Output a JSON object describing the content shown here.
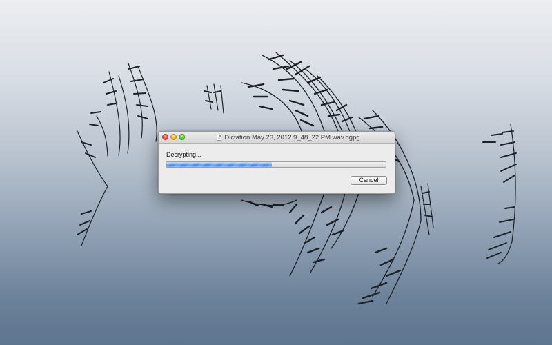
{
  "window": {
    "title": "Dictation May 23, 2012 9_48_22 PM.wav.dgpg",
    "title_icon": "document-icon"
  },
  "dialog": {
    "status_text": "Decrypting...",
    "progress_fraction": 0.48,
    "cancel_label": "Cancel"
  },
  "colors": {
    "progress_blue": "#4a8fe8",
    "close_red": "#f25a4a",
    "minimize_yellow": "#f3bd3a",
    "zoom_green": "#6ccd3e"
  }
}
